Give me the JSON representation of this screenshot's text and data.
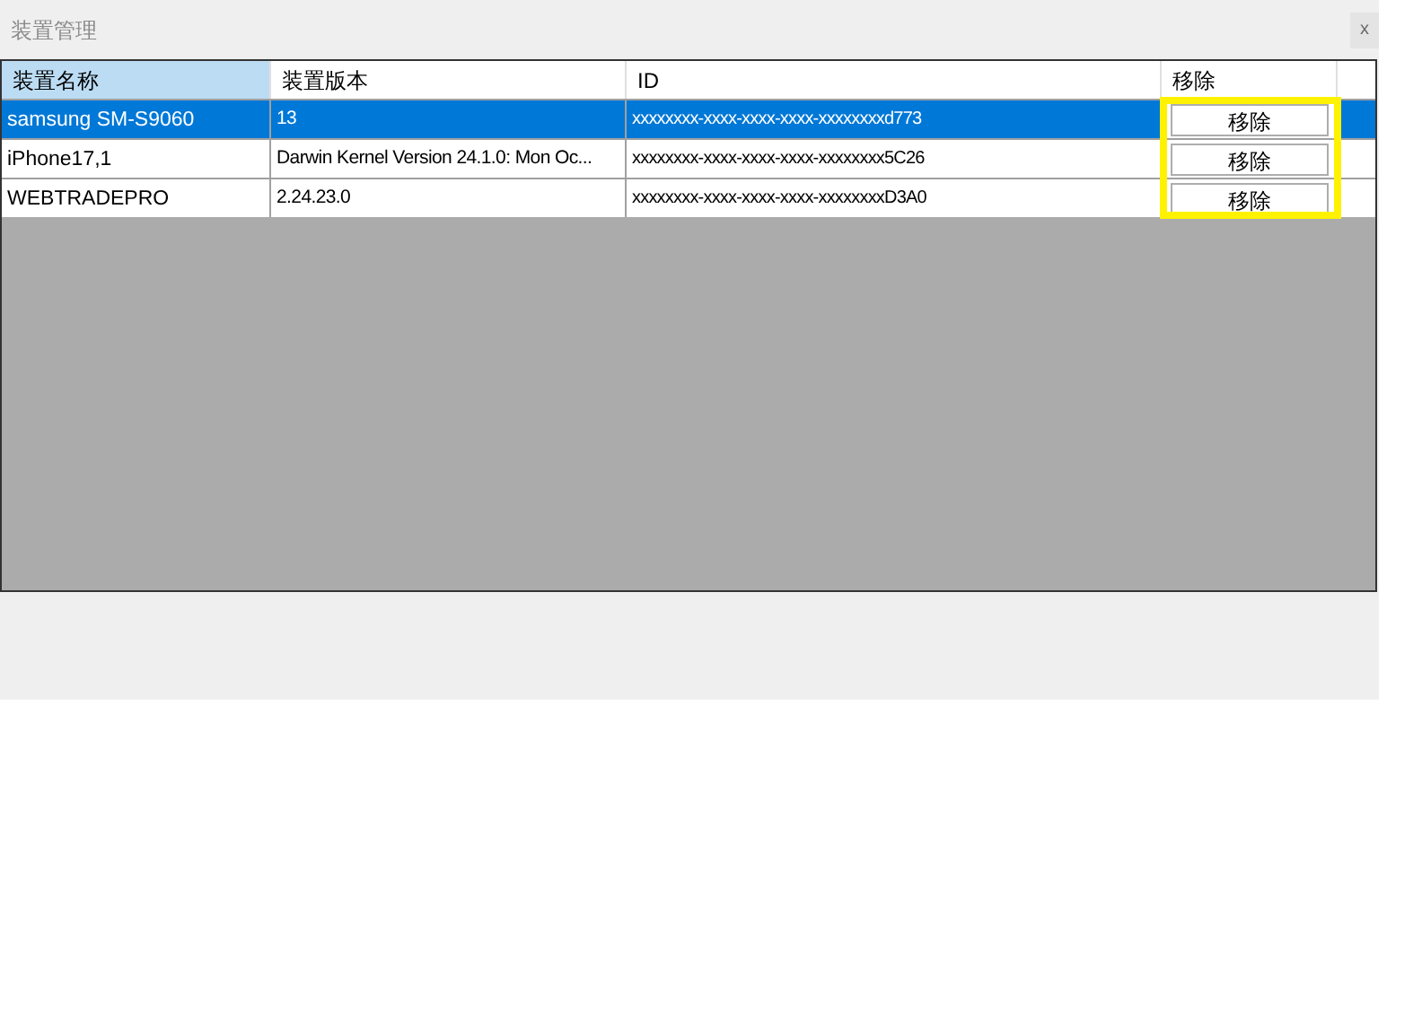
{
  "window": {
    "title": "装置管理",
    "close": "x"
  },
  "table": {
    "columns": [
      {
        "label": "装置名称",
        "selected": true
      },
      {
        "label": "装置版本",
        "selected": false
      },
      {
        "label": "ID",
        "selected": false
      },
      {
        "label": "移除",
        "selected": false
      }
    ],
    "rows": [
      {
        "name": "samsung SM-S9060",
        "version": "13",
        "id": "xxxxxxxx-xxxx-xxxx-xxxx-xxxxxxxxd773",
        "action": "移除",
        "selected": true
      },
      {
        "name": "iPhone17,1",
        "version": "Darwin Kernel Version 24.1.0: Mon Oc...",
        "id": "xxxxxxxx-xxxx-xxxx-xxxx-xxxxxxxx5C26",
        "action": "移除",
        "selected": false
      },
      {
        "name": "WEBTRADEPRO",
        "version": "2.24.23.0",
        "id": "xxxxxxxx-xxxx-xxxx-xxxx-xxxxxxxxD3A0",
        "action": "移除",
        "selected": false
      }
    ],
    "action_column_highlighted": true
  }
}
